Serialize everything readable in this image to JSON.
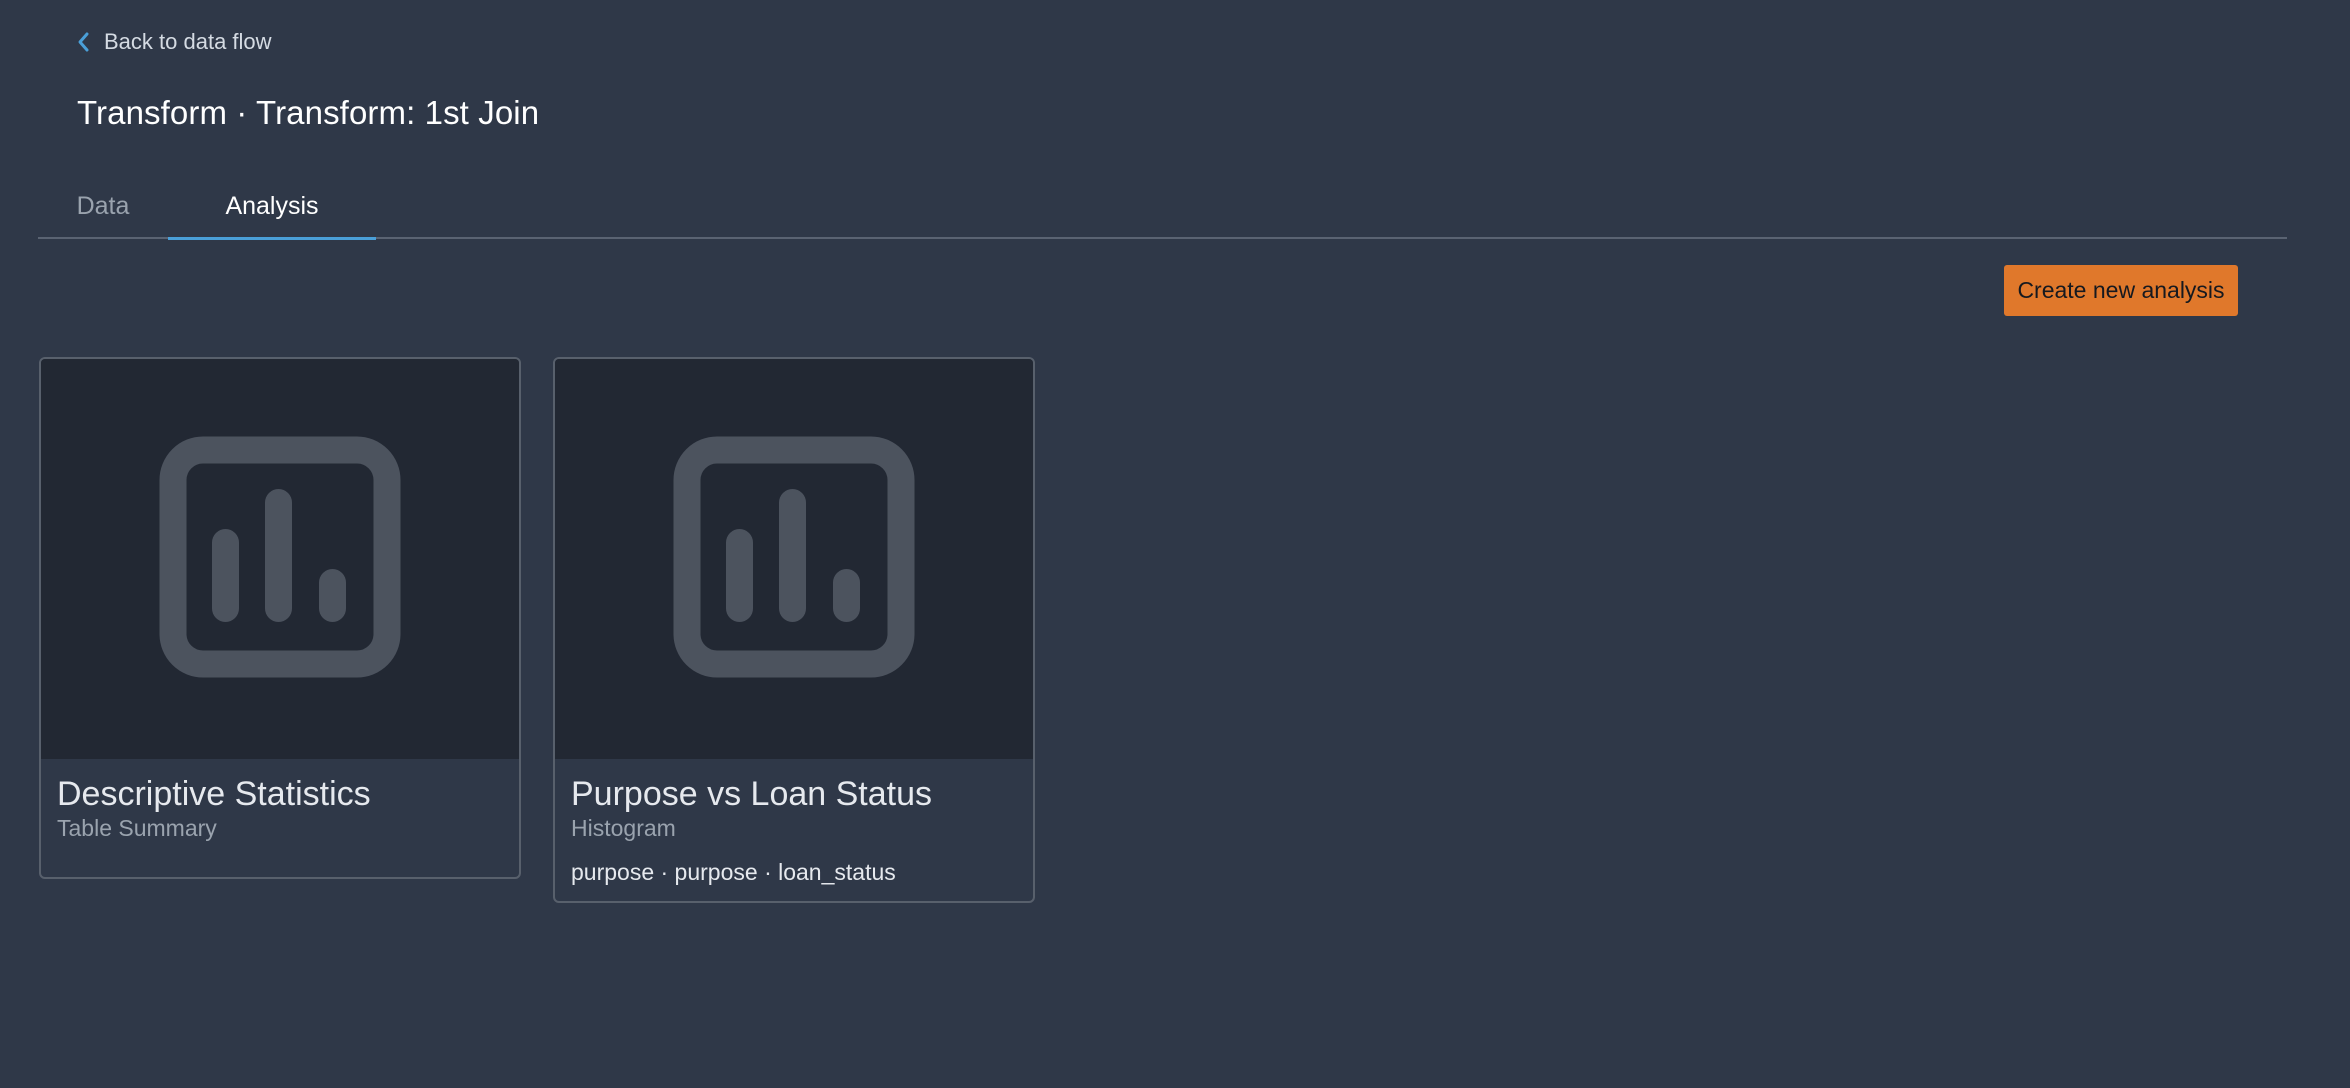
{
  "nav": {
    "back_label": "Back to data flow",
    "back_icon": "chevron-left-icon",
    "accent_color": "#4a9fd8"
  },
  "page": {
    "title": "Transform · Transform: 1st Join"
  },
  "tabs": [
    {
      "label": "Data",
      "selected": false
    },
    {
      "label": "Analysis",
      "selected": true
    }
  ],
  "actions": {
    "create_label": "Create new analysis",
    "create_color": "#e0782b"
  },
  "analyses": [
    {
      "title": "Descriptive Statistics",
      "type": "Table Summary",
      "icon": "bar-chart-icon"
    },
    {
      "title": "Purpose vs Loan Status",
      "type": "Histogram",
      "columns": "purpose · purpose · loan_status",
      "icon": "bar-chart-icon"
    }
  ]
}
